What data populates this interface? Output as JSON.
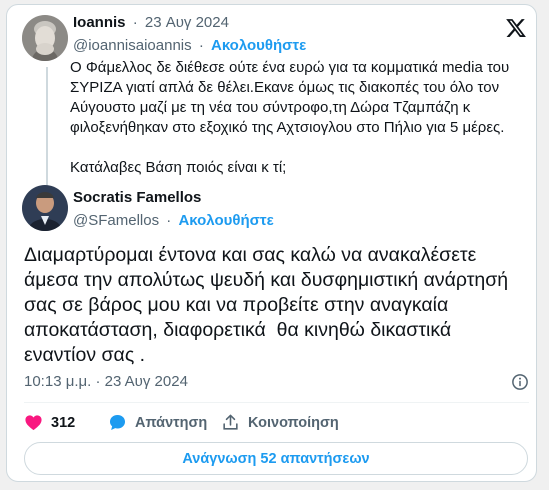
{
  "quoted_tweet": {
    "author_name": "Ioannis",
    "separator": "·",
    "date": "23 Αυγ 2024",
    "handle": "@ioannisaioannis",
    "follow_label": "Ακολουθήστε",
    "text_lines": [
      "Ο Φάμελλος δε διέθεσε ούτε ένα ευρώ για τα κομματικά media του",
      "ΣΥΡΙΖΑ γιατί απλά δε θέλει.Εκανε όμως τις διακοπές του όλο τον",
      "Αύγουστο μαζί με τη νέα του σύντροφο,τη Δώρα Τζαμπάζη κ",
      "φιλοξενήθηκαν στο εξοχικό της Αχτσιογλου στο Πήλιο για 5 μέρες.",
      "",
      "Κατάλαβες Βάση ποιός είναι κ τί;"
    ]
  },
  "reply_tweet": {
    "author_name": "Socratis Famellos",
    "handle": "@SFamellos",
    "separator": "·",
    "follow_label": "Ακολουθήστε",
    "text_lines": [
      "Διαμαρτύρομαι έντονα και σας καλώ να ανακαλέσετε",
      "άμεσα την απολύτως ψευδή και δυσφημιστική ανάρτησή",
      "σας σε βάρος μου και να προβείτε στην αναγκαία",
      "αποκατάσταση, διαφορετικά  θα κινηθώ δικαστικά",
      "εναντίον σας ."
    ],
    "timestamp": "10:13 μ.μ. · 23 Αυγ 2024"
  },
  "actions": {
    "likes": "312",
    "reply_label": "Απάντηση",
    "share_label": "Κοινοποίηση",
    "read_replies_label": "Ανάγνωση 52 απαντήσεων"
  },
  "icons": {
    "logo": "x-logo-icon",
    "info": "info-icon",
    "like": "heart-icon",
    "reply": "speech-bubble-icon",
    "share": "share-icon"
  },
  "colors": {
    "accent": "#1d9bf0",
    "like": "#f91880",
    "text": "#0f1419",
    "muted": "#536471"
  }
}
